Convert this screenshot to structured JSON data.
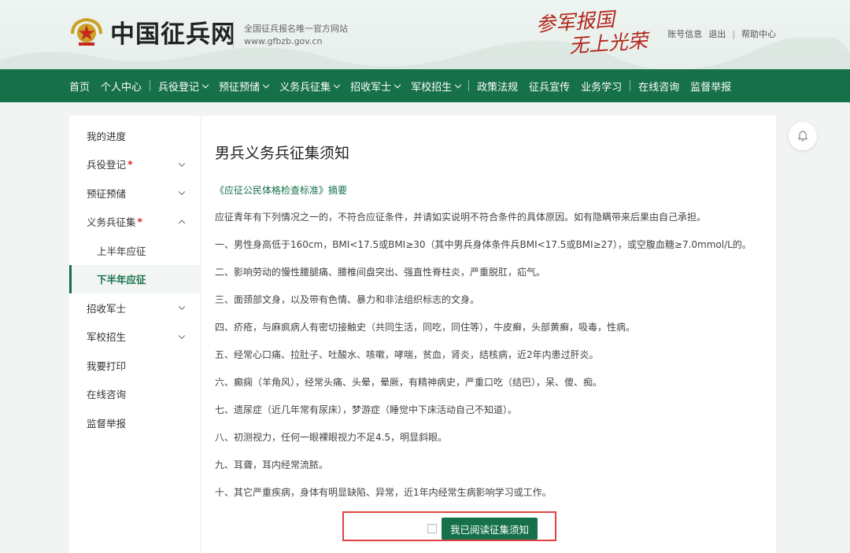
{
  "header": {
    "site_name": "中国征兵网",
    "subtitle": "全国征兵报名唯一官方网站",
    "domain": "www.gfbzb.gov.cn",
    "slogan_line1": "参军报国",
    "slogan_line2": "无上光荣",
    "links": {
      "account": "账号信息",
      "logout": "退出",
      "help": "帮助中心"
    }
  },
  "nav": {
    "items": [
      "首页",
      "个人中心",
      "兵役登记",
      "预征预储",
      "义务兵征集",
      "招收军士",
      "军校招生",
      "政策法规",
      "征兵宣传",
      "业务学习",
      "在线咨询",
      "监督举报"
    ]
  },
  "sidebar": {
    "items": [
      {
        "label": "我的进度"
      },
      {
        "label": "兵役登记",
        "required": "*"
      },
      {
        "label": "预征预储"
      },
      {
        "label": "义务兵征集",
        "required": "*"
      },
      {
        "label": "上半年应征"
      },
      {
        "label": "下半年应征"
      },
      {
        "label": "招收军士"
      },
      {
        "label": "军校招生"
      },
      {
        "label": "我要打印"
      },
      {
        "label": "在线咨询"
      },
      {
        "label": "监督举报"
      }
    ]
  },
  "main": {
    "title": "男兵义务兵征集须知",
    "standard_link": "《应征公民体格检查标准》摘要",
    "intro": "应征青年有下列情况之一的，不符合应征条件，并请如实说明不符合条件的具体原因。如有隐瞒带来后果由自己承担。",
    "items": [
      "一、男性身高低于160cm，BMI<17.5或BMI≥30（其中男兵身体条件兵BMI<17.5或BMI≥27），或空腹血糖≥7.0mmol/L的。",
      "二、影响劳动的慢性腰腿痛、腰椎间盘突出、强直性脊柱炎，严重脱肛，疝气。",
      "三、面颈部文身，以及带有色情、暴力和非法组织标志的文身。",
      "四、疥疮，与麻疯病人有密切接触史（共同生活，同吃，同住等），牛皮癣，头部黄癣，吸毒，性病。",
      "五、经常心口痛、拉肚子、吐酸水、咳嗽，哮喘，贫血，肾炎，结核病，近2年内患过肝炎。",
      "六、癫痫（羊角风），经常头痛、头晕，晕厥，有精神病史，严重口吃（结巴），呆、傻、痴。",
      "七、遗尿症（近几年常有尿床），梦游症（睡觉中下床活动自己不知道）。",
      "八、初测视力，任何一眼裸眼视力不足4.5，明显斜眼。",
      "九、耳聋，耳内经常流脓。",
      "十、其它严重疾病，身体有明显缺陷、异常，近1年内经常生病影响学习或工作。"
    ],
    "confirm_label": "我已阅读征集须知"
  },
  "colors": {
    "primary": "#16704a",
    "highlight": "#e0433f",
    "required": "#dd2222"
  },
  "icons": {
    "emblem": "army-emblem-icon",
    "bell": "bell-icon",
    "chevron": "chevron-down-icon"
  }
}
